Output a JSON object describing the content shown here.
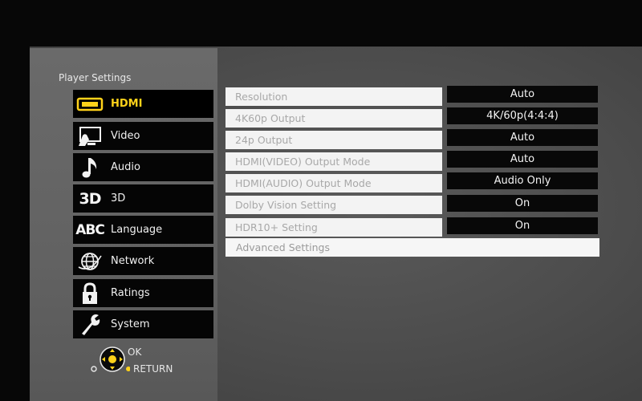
{
  "sidebar": {
    "title": "Player Settings",
    "items": [
      {
        "label": "HDMI",
        "icon": "hdmi-icon",
        "active": true
      },
      {
        "label": "Video",
        "icon": "video-icon"
      },
      {
        "label": "Audio",
        "icon": "music-note-icon"
      },
      {
        "label": "3D",
        "icon": "3d-icon",
        "icon_text": "3D"
      },
      {
        "label": "Language",
        "icon": "abc-icon",
        "icon_text": "ABC"
      },
      {
        "label": "Network",
        "icon": "globe-icon"
      },
      {
        "label": "Ratings",
        "icon": "lock-icon"
      },
      {
        "label": "System",
        "icon": "wrench-icon"
      }
    ]
  },
  "settings": {
    "rows": [
      {
        "label": "Resolution",
        "value": "Auto"
      },
      {
        "label": "4K60p Output",
        "value": "4K/60p(4:4:4)"
      },
      {
        "label": "24p Output",
        "value": "Auto"
      },
      {
        "label": "HDMI(VIDEO) Output Mode",
        "value": "Auto"
      },
      {
        "label": "HDMI(AUDIO) Output Mode",
        "value": "Audio Only"
      },
      {
        "label": "Dolby Vision Setting",
        "value": "On"
      },
      {
        "label": "HDR10+ Setting",
        "value": "On"
      }
    ],
    "advanced_label": "Advanced Settings"
  },
  "hints": {
    "ok": "OK",
    "return": "RETURN"
  },
  "colors": {
    "active": "#ffd21a",
    "item_bg": "#050505",
    "row_label_bg": "#f3f3f3",
    "row_value_bg": "#080808"
  }
}
